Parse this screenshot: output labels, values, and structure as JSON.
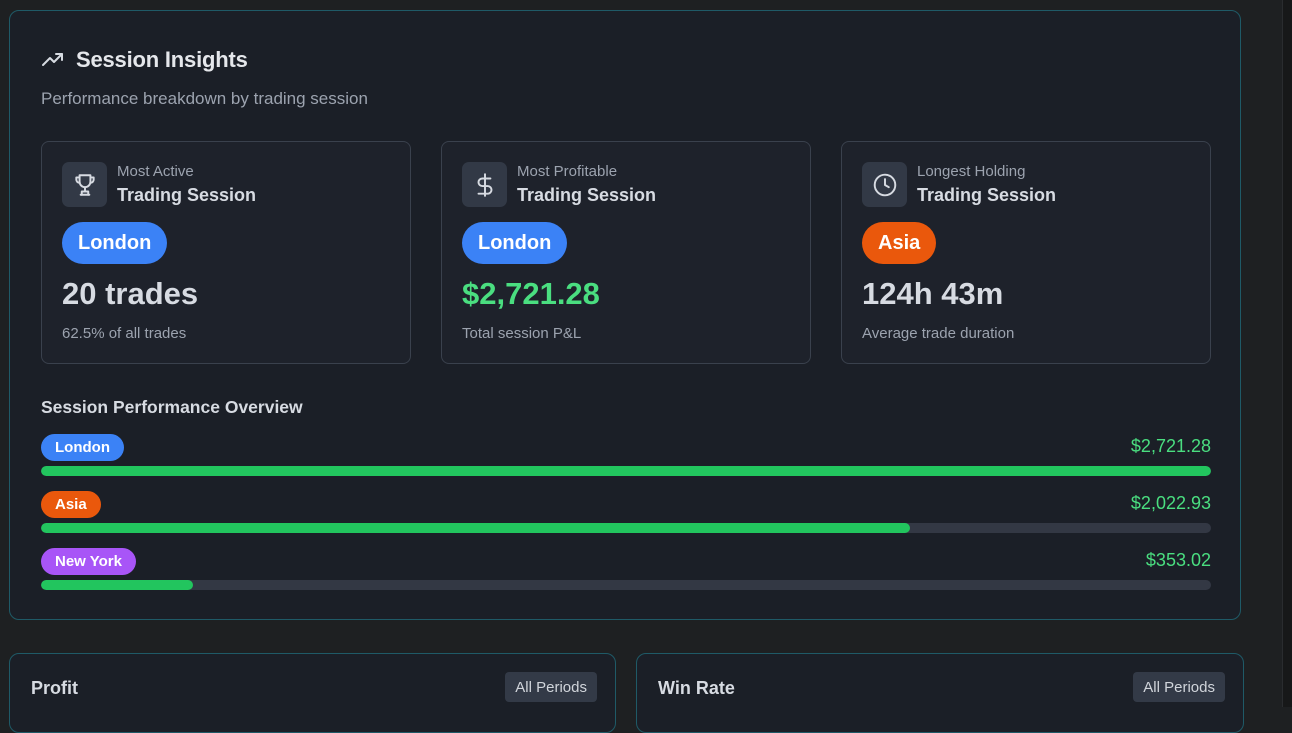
{
  "insights": {
    "title": "Session Insights",
    "subtitle": "Performance breakdown by trading session",
    "icon": "trending-up-icon",
    "cards": [
      {
        "icon": "trophy-icon",
        "caption_top": "Most Active",
        "caption_bottom": "Trading Session",
        "session": "London",
        "session_color": "#3b82f6",
        "value": "20 trades",
        "value_color": "#d7dbe2",
        "note": "62.5% of all trades"
      },
      {
        "icon": "dollar-icon",
        "caption_top": "Most Profitable",
        "caption_bottom": "Trading Session",
        "session": "London",
        "session_color": "#3b82f6",
        "value": "$2,721.28",
        "value_color": "#4ade80",
        "note": "Total session P&L"
      },
      {
        "icon": "clock-icon",
        "caption_top": "Longest Holding",
        "caption_bottom": "Trading Session",
        "session": "Asia",
        "session_color": "#ea580c",
        "value": "124h 43m",
        "value_color": "#d7dbe2",
        "note": "Average trade duration"
      }
    ]
  },
  "overview": {
    "title": "Session Performance Overview",
    "bar_color": "#22c55e",
    "rows": [
      {
        "session": "London",
        "color": "#3b82f6",
        "amount": "$2,721.28",
        "fraction": 1.0
      },
      {
        "session": "Asia",
        "color": "#ea580c",
        "amount": "$2,022.93",
        "fraction": 0.743
      },
      {
        "session": "New York",
        "color": "#a855f7",
        "amount": "$353.02",
        "fraction": 0.13
      }
    ]
  },
  "bottom_panels": [
    {
      "title": "Profit",
      "filter": "All Periods"
    },
    {
      "title": "Win Rate",
      "filter": "All Periods"
    }
  ]
}
